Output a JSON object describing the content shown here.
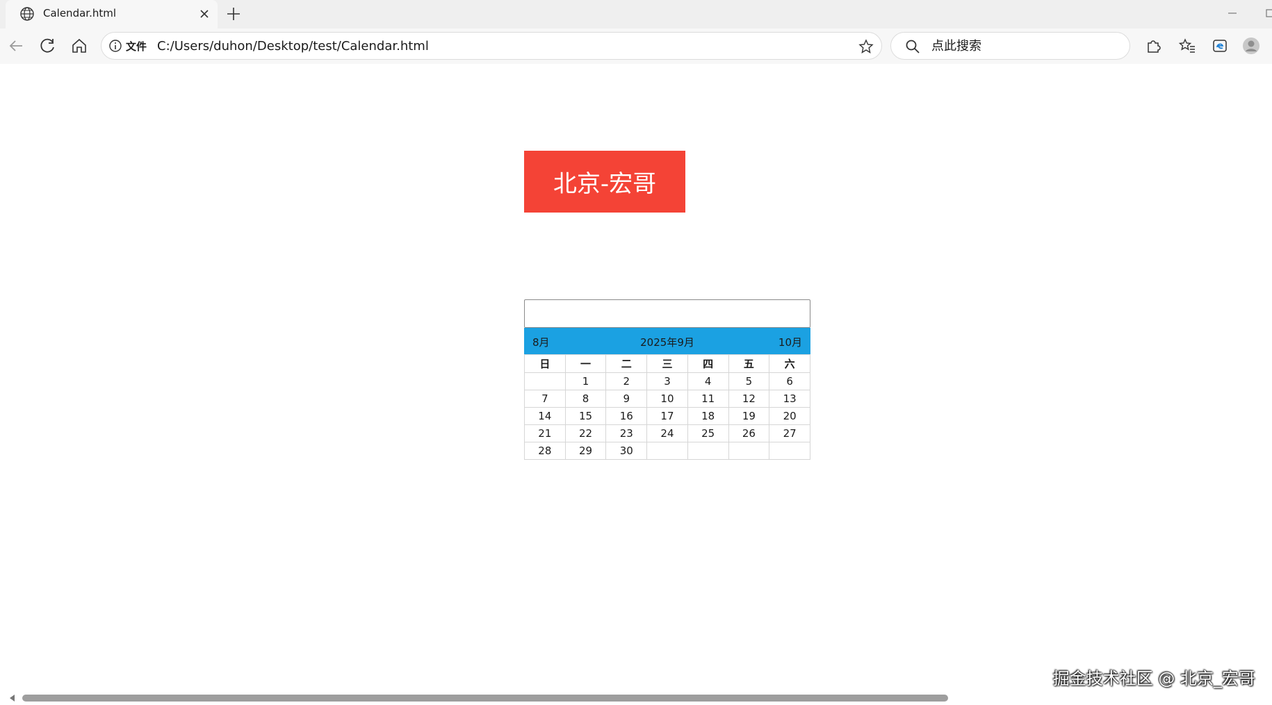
{
  "browser": {
    "tab_title": "Calendar.html",
    "address_scheme": "文件",
    "address_url": "C:/Users/duhon/Desktop/test/Calendar.html",
    "search_placeholder": "点此搜索"
  },
  "page": {
    "banner_text": "北京-宏哥",
    "date_input_value": "",
    "calendar": {
      "prev_label": "8月",
      "current_label": "2025年9月",
      "next_label": "10月",
      "weekdays": [
        "日",
        "一",
        "二",
        "三",
        "四",
        "五",
        "六"
      ],
      "weeks": [
        [
          "",
          "1",
          "2",
          "3",
          "4",
          "5",
          "6"
        ],
        [
          "7",
          "8",
          "9",
          "10",
          "11",
          "12",
          "13"
        ],
        [
          "14",
          "15",
          "16",
          "17",
          "18",
          "19",
          "20"
        ],
        [
          "21",
          "22",
          "23",
          "24",
          "25",
          "26",
          "27"
        ],
        [
          "28",
          "29",
          "30",
          "",
          "",
          "",
          ""
        ]
      ],
      "header_color": "#1ba1e2"
    },
    "banner_color": "#f44336"
  },
  "watermark": "掘金技术社区 @ 北京_宏哥"
}
